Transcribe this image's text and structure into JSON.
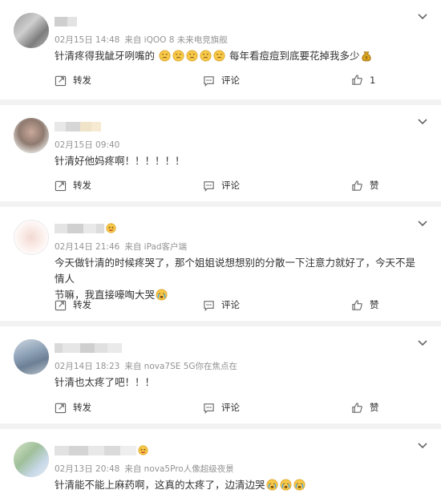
{
  "actions": {
    "repost": "转发",
    "comment": "评论"
  },
  "comments": [
    {
      "time": "02月15日 14:48",
      "source": "来自 iQOO 8 未来电竞旗舰",
      "text_before": "针清疼得我龇牙咧嘴的",
      "text_after": "每年看痘痘到底要花掉我多少",
      "like_label": "1",
      "emoji": "pained-face"
    },
    {
      "time": "02月15日 09:40",
      "source": "",
      "text_before": "针清好他妈疼啊！！！！！！",
      "like_label": "赞"
    },
    {
      "time": "02月14日 21:46",
      "source": "来自 iPad客户端",
      "text_line1": "今天做针清的时候疼哭了，那个姐姐说想想别的分散一下注意力就好了，今天不是情人",
      "text_line2": "节嘛，我直接嚎啕大哭",
      "like_label": "赞"
    },
    {
      "time": "02月14日 18:23",
      "source": "来自 nova7SE 5G你在焦点在",
      "text_before": "针清也太疼了吧！！！",
      "like_label": "赞"
    },
    {
      "time": "02月13日 20:48",
      "source": "来自 nova5Pro人像超级夜景",
      "text_before": "针清能不能上麻药啊，这真的太疼了，边清边哭",
      "like_label": "赞"
    }
  ]
}
